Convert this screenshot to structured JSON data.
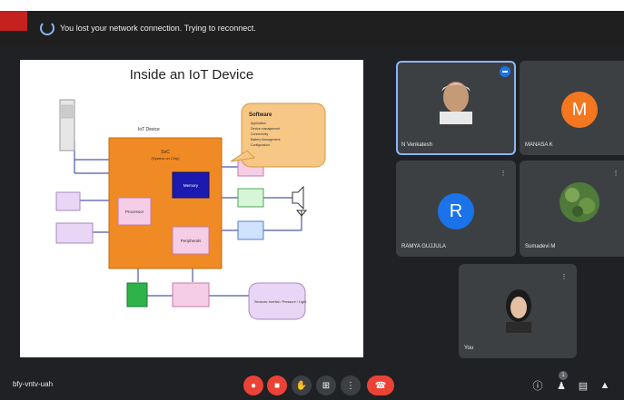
{
  "notification": {
    "text": "You lost your network connection. Trying to reconnect."
  },
  "slide": {
    "title": "Inside an IoT Device",
    "blocks": {
      "iot_device": "IoT Device",
      "soc": "SoC",
      "soc_sub": "(System on Chip)",
      "memory": "Memory",
      "processor": "Processor",
      "peripherals": "Peripherals",
      "software_title": "Software",
      "software_items": [
        "Application",
        "Device management",
        "Connectivity",
        "Battery Management",
        "Configuration"
      ],
      "sensors_note": "Sensors: Inertial / Pressure / Light"
    },
    "colors": {
      "soc": "#f08a24",
      "memory": "#1a1ab0",
      "pink": "#f6cde6",
      "green_box": "#2db34a",
      "pale_green": "#d7f5d7",
      "blue_box": "#cfe2ff",
      "lavender": "#e9d5f5",
      "callout": "#f7c785"
    }
  },
  "participants": [
    {
      "name": "N Venkatesh",
      "kind": "photo",
      "active": true,
      "speaking": true
    },
    {
      "name": "MANASA K",
      "initial": "M",
      "avatar_color": "#f4761f",
      "kind": "initial",
      "muted": false
    },
    {
      "name": "RAMYA GUJJULA",
      "initial": "R",
      "avatar_color": "#1a73e8",
      "kind": "initial",
      "muted": true
    },
    {
      "name": "Sumadevi M",
      "kind": "photo",
      "muted": true
    },
    {
      "name": "You",
      "kind": "photo",
      "muted": true
    }
  ],
  "bottombar": {
    "meeting_code": "bfy-vntv-uah",
    "participant_count": "1"
  },
  "icons": {
    "spinner": "loading-spinner-icon",
    "mic": "mic-off-icon",
    "camera": "camera-off-icon",
    "hand": "raise-hand-icon",
    "present": "present-screen-icon",
    "more": "more-options-icon",
    "end_call": "end-call-icon",
    "info": "info-icon",
    "people": "people-icon",
    "chat": "chat-icon",
    "activities": "activities-icon"
  }
}
